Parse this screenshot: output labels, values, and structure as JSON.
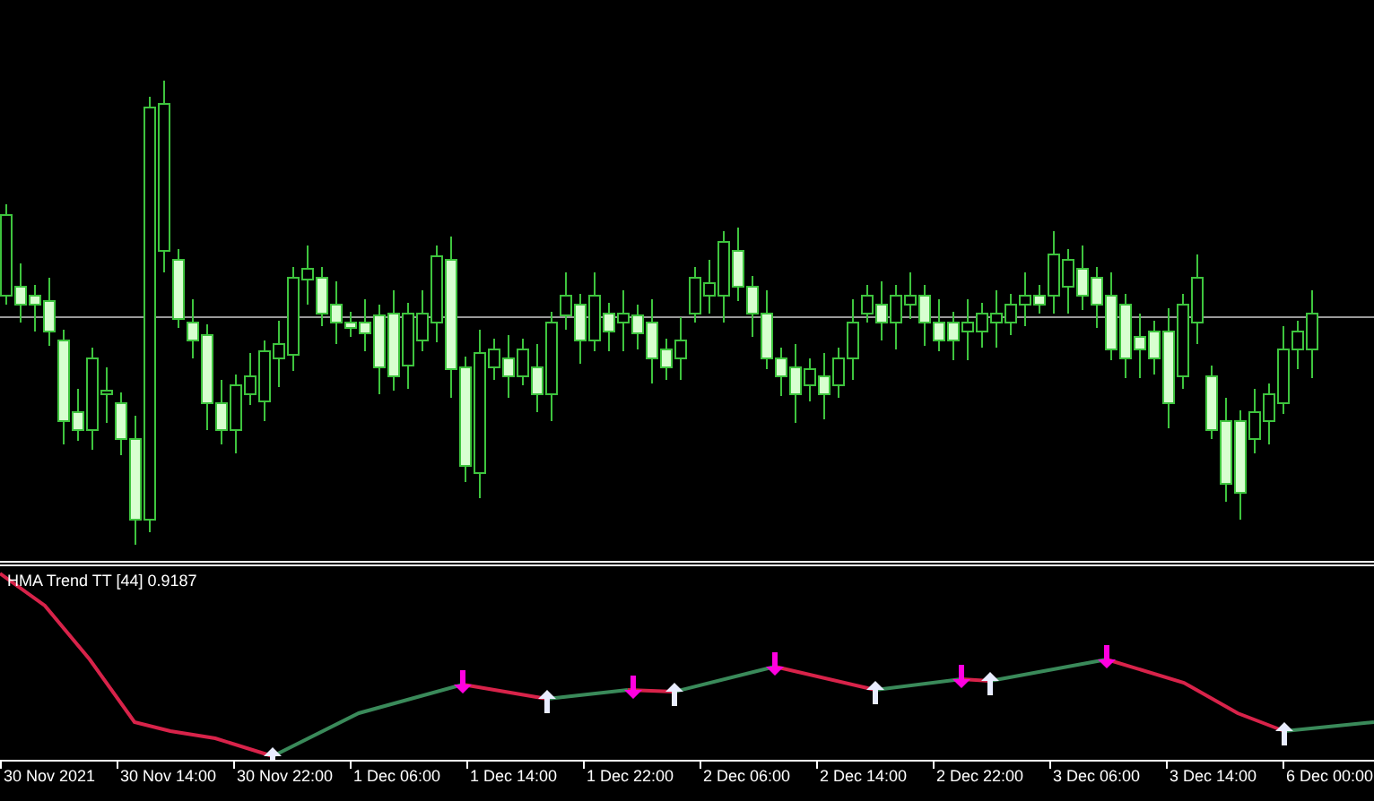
{
  "indicator": {
    "label": "HMA Trend TT [44] 0.9187"
  },
  "time_axis": {
    "labels": [
      "30 Nov 2021",
      "30 Nov 14:00",
      "30 Nov 22:00",
      "1 Dec 06:00",
      "1 Dec 14:00",
      "1 Dec 22:00",
      "2 Dec 06:00",
      "2 Dec 14:00",
      "2 Dec 22:00",
      "3 Dec 06:00",
      "3 Dec 14:00",
      "6 Dec 00:00"
    ]
  }
}
